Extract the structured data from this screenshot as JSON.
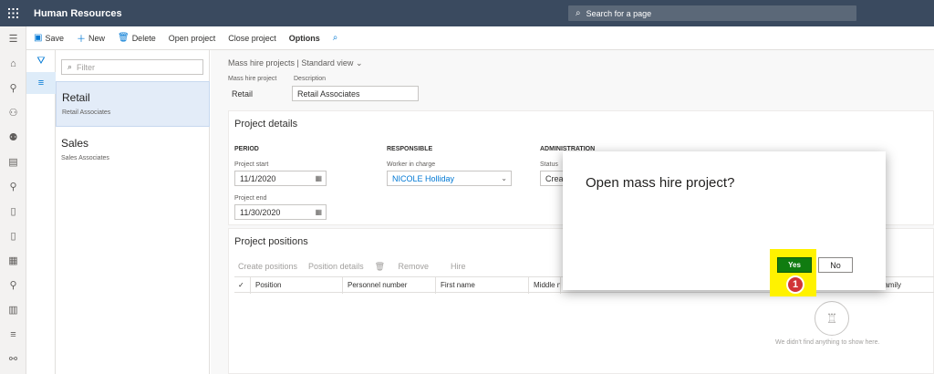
{
  "app": {
    "title": "Human Resources"
  },
  "search": {
    "placeholder": "Search for a page"
  },
  "actions": [
    {
      "label": "Save",
      "icon": "save-icon"
    },
    {
      "label": "New",
      "icon": "plus-icon"
    },
    {
      "label": "Delete",
      "icon": "trash-icon"
    },
    {
      "label": "Open project"
    },
    {
      "label": "Close project"
    },
    {
      "label": "Options"
    }
  ],
  "filter": {
    "placeholder": "Filter"
  },
  "list": [
    {
      "title": "Retail",
      "subtitle": "Retail Associates",
      "selected": true
    },
    {
      "title": "Sales",
      "subtitle": "Sales Associates",
      "selected": false
    }
  ],
  "breadcrumb": {
    "text": "Mass hire projects",
    "view": "Standard view"
  },
  "header": {
    "project_label": "Mass hire project",
    "project_value": "Retail",
    "desc_label": "Description",
    "desc_value": "Retail Associates"
  },
  "details": {
    "title": "Project details",
    "period": "PERIOD",
    "responsible": "RESPONSIBLE",
    "administration": "ADMINISTRATION",
    "start_label": "Project start",
    "start_value": "11/1/2020",
    "end_label": "Project end",
    "end_value": "11/30/2020",
    "worker_label": "Worker in charge",
    "worker_value": "NICOLE Holliday",
    "status_label": "Status",
    "status_value": "Create"
  },
  "positions": {
    "title": "Project positions",
    "tools": [
      "Create positions",
      "Position details",
      "Remove",
      "Hire"
    ],
    "columns": [
      "Position",
      "Personnel number",
      "First name",
      "Middle na",
      "Job family"
    ],
    "empty_text": "We didn't find anything to show here."
  },
  "dialog": {
    "title": "Open mass hire project?",
    "yes": "Yes",
    "no": "No",
    "callout": "1"
  },
  "colors": {
    "topbar": "#3a4a5f",
    "accent": "#0078d4",
    "yes": "#107c10",
    "highlight": "#fff200",
    "badge": "#d13438"
  }
}
